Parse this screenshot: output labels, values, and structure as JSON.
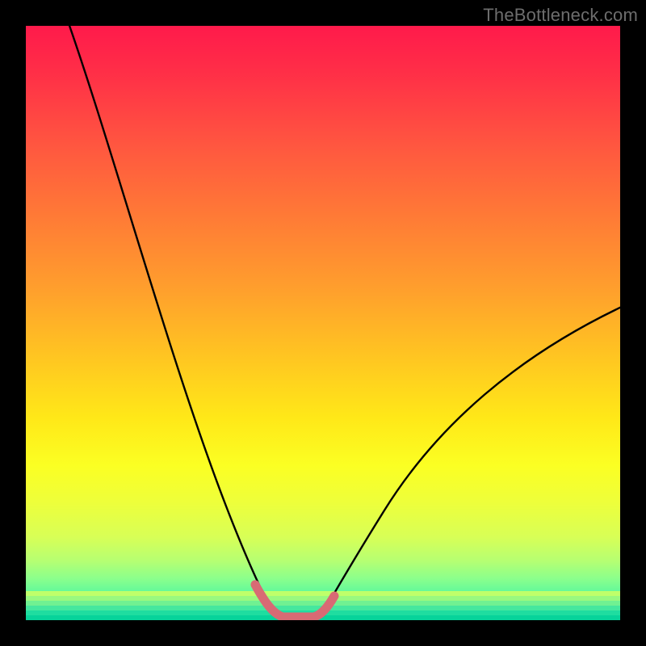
{
  "watermark": "TheBottleneck.com",
  "gradient_colors": [
    "#ff1a4b",
    "#ffe818",
    "#00d99b"
  ],
  "chart_data": {
    "type": "line",
    "title": "",
    "xlabel": "",
    "ylabel": "",
    "xlim": [
      0,
      100
    ],
    "ylim": [
      0,
      100
    ],
    "series": [
      {
        "name": "left-curve",
        "x": [
          7,
          10,
          14,
          18,
          22,
          26,
          30,
          33,
          36,
          38,
          40,
          41.5
        ],
        "y": [
          100,
          88,
          74,
          61,
          49,
          37,
          26,
          17,
          10,
          5,
          2,
          0.5
        ]
      },
      {
        "name": "valley-floor",
        "x": [
          41.5,
          44,
          46,
          48,
          50
        ],
        "y": [
          0.5,
          0,
          0,
          0,
          0.5
        ]
      },
      {
        "name": "right-curve",
        "x": [
          50,
          53,
          57,
          62,
          68,
          75,
          83,
          92,
          100
        ],
        "y": [
          0.5,
          2.5,
          6,
          11,
          18,
          26,
          35,
          45,
          53
        ]
      },
      {
        "name": "valley-highlight",
        "x": [
          38,
          40,
          42,
          44,
          46,
          48,
          50,
          51.5
        ],
        "y": [
          6,
          2,
          0.5,
          0,
          0,
          0,
          0.5,
          2.5
        ]
      }
    ],
    "annotations": []
  }
}
